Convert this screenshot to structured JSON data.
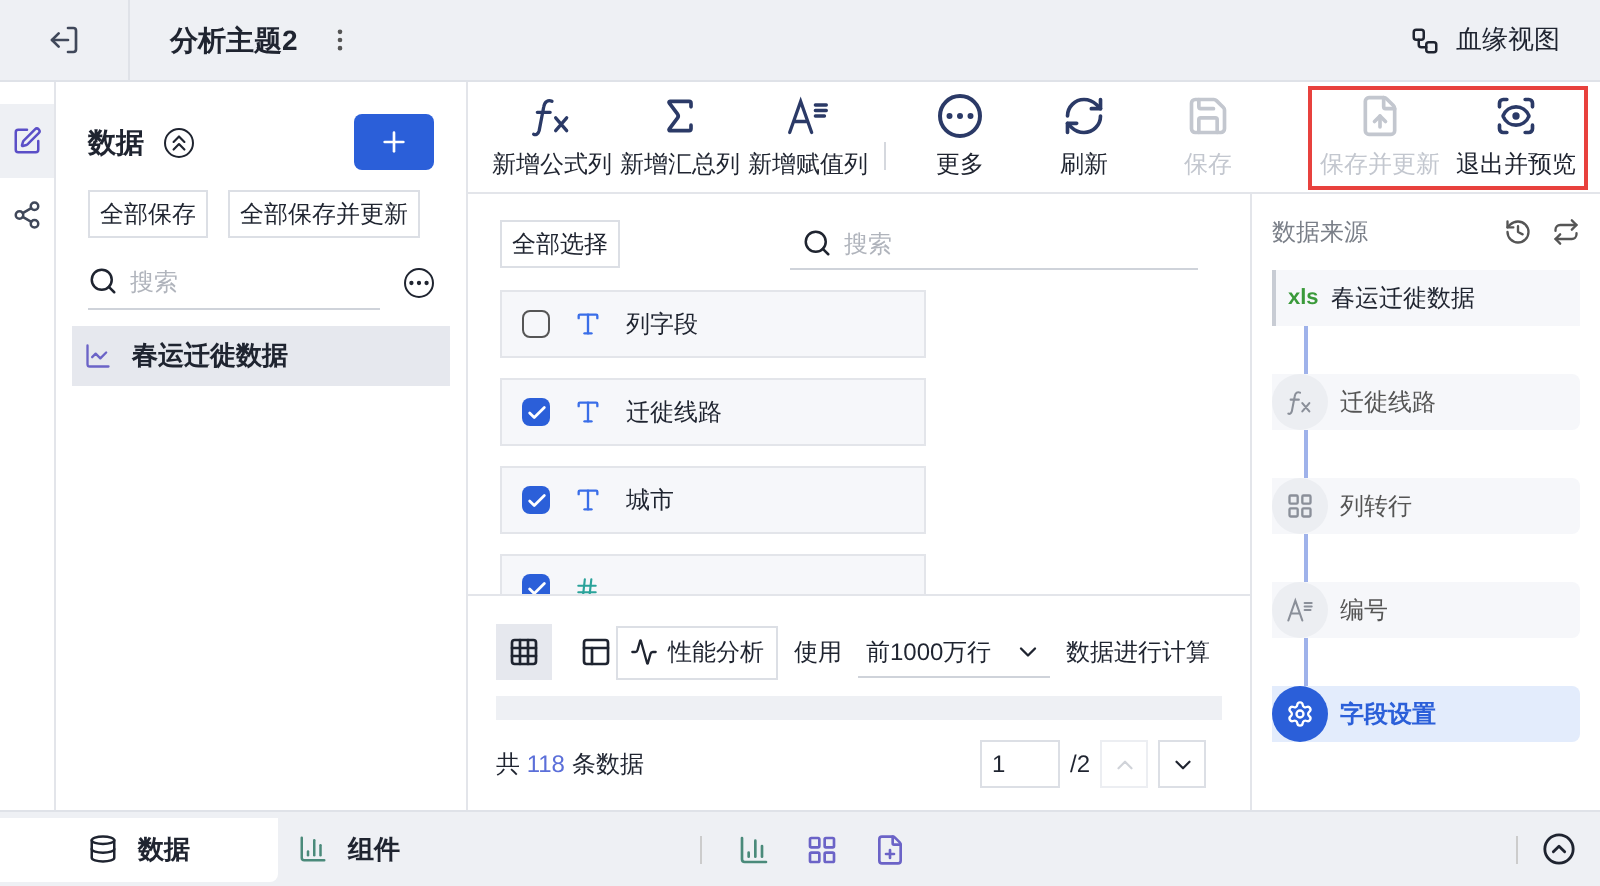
{
  "header": {
    "title": "分析主题2",
    "lineage": "血缘视图"
  },
  "rail": [
    {
      "kind": "data",
      "selected": true
    },
    {
      "kind": "relation",
      "selected": false
    }
  ],
  "data_panel": {
    "title": "数据",
    "buttons": [
      "全部保存",
      "全部保存并更新"
    ],
    "search": {
      "placeholder": "搜索"
    },
    "items": [
      {
        "name": "春运迁徙数据",
        "selected": true
      }
    ]
  },
  "toolbar": {
    "groups": [
      {
        "framed": false,
        "items": [
          {
            "label": "新增公式列",
            "kind": "formula",
            "disabled": false
          },
          {
            "label": "新增汇总列",
            "kind": "sum",
            "disabled": false
          },
          {
            "label": "新增赋值列",
            "kind": "assign",
            "disabled": false
          }
        ]
      },
      {
        "framed": false,
        "items": [
          {
            "label": "更多",
            "kind": "more",
            "disabled": false
          },
          {
            "label": "刷新",
            "kind": "refresh",
            "disabled": false
          },
          {
            "label": "保存",
            "kind": "save",
            "disabled": true
          }
        ]
      },
      {
        "framed": true,
        "items": [
          {
            "label": "保存并更新",
            "kind": "save-update",
            "disabled": true
          },
          {
            "label": "退出并预览",
            "kind": "preview",
            "disabled": false
          }
        ]
      }
    ]
  },
  "fields": {
    "select_all": "全部选择",
    "search": {
      "placeholder": "搜索"
    },
    "items": [
      {
        "name": "列字段",
        "kind": "text",
        "checked": false
      },
      {
        "name": "迁徙线路",
        "kind": "text",
        "checked": true
      },
      {
        "name": "城市",
        "kind": "text",
        "checked": true
      },
      {
        "kind": "number",
        "checked": true
      }
    ]
  },
  "preview": {
    "views": [
      {
        "kind": "grid",
        "selected": true
      },
      {
        "kind": "layout",
        "selected": false
      }
    ],
    "perf": "性能分析",
    "use": "使用",
    "rows": "前1000万行",
    "compute": "数据进行计算",
    "total_prefix": "共",
    "total": "118",
    "total_suffix": "条数据",
    "page": "1",
    "pages": "/2"
  },
  "steps": {
    "title": "数据来源",
    "items": [
      {
        "kind": "source",
        "badge": "xls",
        "name": "春运迁徙数据",
        "selected": false
      },
      {
        "kind": "formula",
        "name": "迁徙线路",
        "selected": false
      },
      {
        "kind": "transpose",
        "name": "列转行",
        "selected": false
      },
      {
        "kind": "number",
        "name": "编号",
        "selected": false
      },
      {
        "kind": "settings",
        "name": "字段设置",
        "selected": true
      }
    ]
  },
  "bottom_tabs": [
    {
      "label": "数据",
      "kind": "data",
      "selected": true
    },
    {
      "label": "组件",
      "kind": "widget",
      "selected": false
    }
  ]
}
